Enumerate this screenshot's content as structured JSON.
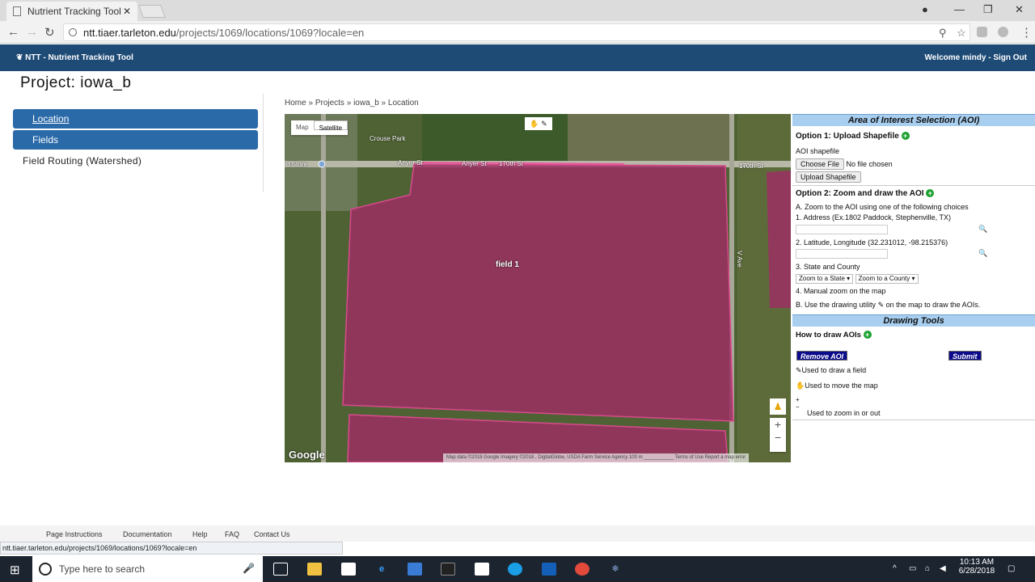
{
  "browser": {
    "tab_title": "Nutrient Tracking Tool (N",
    "url_host": "ntt.tiaer.tarleton.edu",
    "url_path": "/projects/1069/locations/1069?locale=en"
  },
  "header": {
    "brand": "NTT - Nutrient Tracking Tool",
    "welcome": "Welcome mindy - Sign Out"
  },
  "project_title": "Project: iowa_b",
  "sidebar": {
    "items": [
      {
        "label": "Location"
      },
      {
        "label": "Fields"
      },
      {
        "label": "Field Routing (Watershed)"
      }
    ]
  },
  "breadcrumb": {
    "home": "Home",
    "projects": "Projects",
    "project": "iowa_b",
    "current": "Location",
    "sep": "»"
  },
  "map": {
    "type_map": "Map",
    "type_satellite": "Satellite",
    "labels": {
      "crouse_park": "Crouse Park",
      "store": "d Store",
      "anyer1": "Anyer St",
      "anyer2": "Anyer St",
      "st170a": "170th St",
      "st170b": "170th St",
      "vave": "V Ave"
    },
    "field_label": "field 1",
    "google": "Google",
    "attribution": "Map data ©2018 Google Imagery ©2018 , DigitalGlobe, USDA Farm Service Agency   100 m ___________   Terms of Use   Report a map error",
    "zoom_in": "+",
    "zoom_out": "−"
  },
  "panel": {
    "aoi_title": "Area of Interest Selection (AOI)",
    "option1": "Option 1: Upload Shapefile",
    "aoi_shapefile": "AOI shapefile",
    "choose_file": "Choose File",
    "no_file": "No file chosen",
    "upload": "Upload Shapefile",
    "option2": "Option 2: Zoom and draw the AOI",
    "a_zoom": "A. Zoom to the AOI using one of the following choices",
    "address": "1. Address (Ex.1802 Paddock, Stephenville, TX)",
    "latlong": "2. Latitude, Longitude (32.231012, -98.215376)",
    "state_county": "3. State and County",
    "zoom_state": "Zoom to a State ▾",
    "zoom_county": "Zoom to a County ▾",
    "manual_zoom": "4. Manual zoom on the map",
    "b_use": "B. Use the drawing utility",
    "b_use_rest": "on the map to draw the AOIs.",
    "drawing_tools": "Drawing Tools",
    "how_to_draw": "How to draw AOIs",
    "remove_aoi": "Remove AOI",
    "submit": "Submit",
    "draw_field": "Used to draw a field",
    "move_map": "Used to move the map",
    "zoom_inout": "Used to zoom in or out"
  },
  "footer": {
    "links": [
      "Page Instructions",
      "Documentation",
      "Help",
      "FAQ",
      "Contact Us"
    ]
  },
  "status_url": "ntt.tiaer.tarleton.edu/projects/1069/locations/1069?locale=en",
  "taskbar": {
    "search_placeholder": "Type here to search",
    "time": "10:13 AM",
    "date": "6/28/2018"
  }
}
